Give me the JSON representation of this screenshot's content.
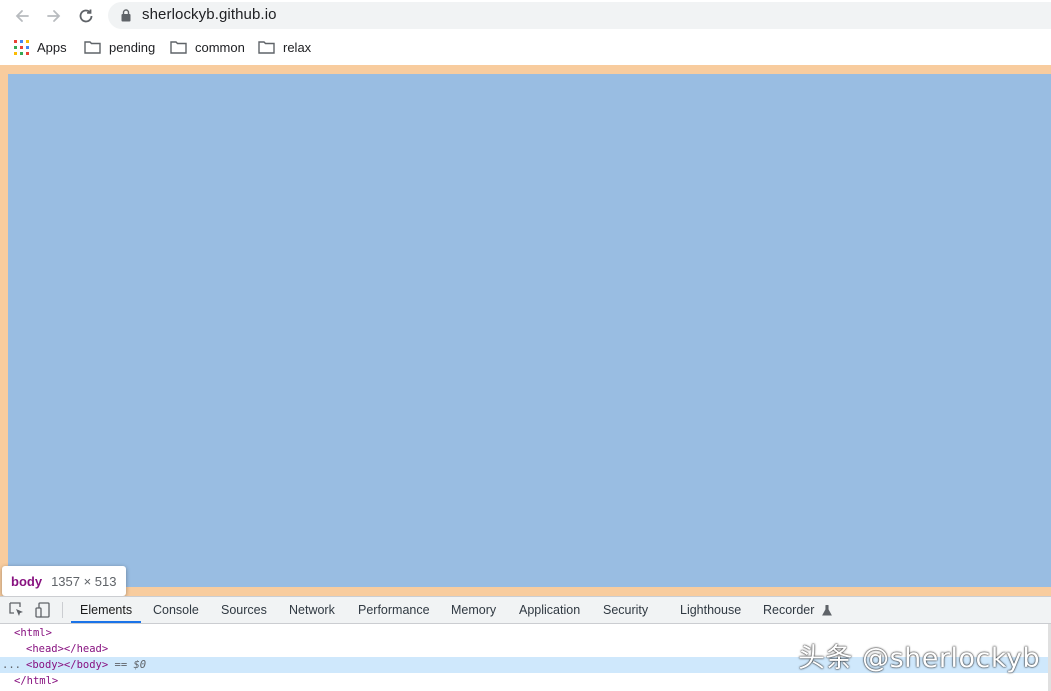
{
  "browser": {
    "url": "sherlockyb.github.io",
    "back_icon": "arrow-left-icon",
    "forward_icon": "arrow-right-icon",
    "reload_icon": "reload-icon",
    "lock_icon": "lock-icon"
  },
  "bookmarks": [
    {
      "label": "Apps",
      "icon": "apps-grid-icon"
    },
    {
      "label": "pending",
      "icon": "folder-icon"
    },
    {
      "label": "common",
      "icon": "folder-icon"
    },
    {
      "label": "relax",
      "icon": "folder-icon"
    }
  ],
  "colors": {
    "margin_highlight": "#f8cc9e",
    "content_highlight": "#99bde2",
    "active_tab_underline": "#1a73e8",
    "tag_color": "#881280"
  },
  "inspector_tooltip": {
    "tag": "body",
    "dimensions": "1357 × 513"
  },
  "devtools": {
    "tabs": [
      {
        "label": "Elements",
        "active": true
      },
      {
        "label": "Console"
      },
      {
        "label": "Sources"
      },
      {
        "label": "Network"
      },
      {
        "label": "Performance"
      },
      {
        "label": "Memory"
      },
      {
        "label": "Application"
      },
      {
        "label": "Security"
      },
      {
        "label": "Lighthouse"
      },
      {
        "label": "Recorder",
        "icon": "flask-icon"
      }
    ],
    "dom": {
      "html_open": "<html>",
      "head": "<head></head>",
      "body": "<body></body>",
      "selected_marker": "== $0",
      "ellipsis": "...",
      "html_close": "</html>"
    }
  },
  "watermark": "头条 @sherlockyb"
}
